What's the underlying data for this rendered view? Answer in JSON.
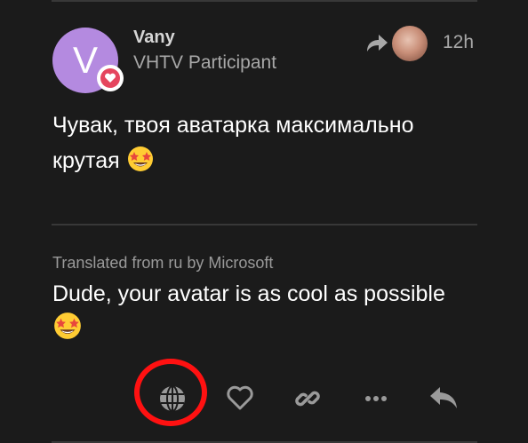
{
  "post": {
    "avatar_letter": "V",
    "avatar_color": "#b48ae0",
    "badge_color": "#e5455e",
    "username": "Vany",
    "user_title": "VHTV Participant",
    "reply_icon": "reply-arrow-icon",
    "time": "12h",
    "text_line1": "Чувак, твоя аватарка максимально",
    "text_line2": "крутая",
    "emoji": "star-struck-emoji"
  },
  "translation": {
    "source_label": "Translated from ru by Microsoft",
    "text": "Dude, your avatar is as cool as possible"
  },
  "actions": {
    "icons": [
      "globe-icon",
      "heart-icon",
      "link-icon",
      "more-icon",
      "reply-icon"
    ],
    "icon_color": "#9a9a9a",
    "highlight_color": "#ff1111"
  }
}
